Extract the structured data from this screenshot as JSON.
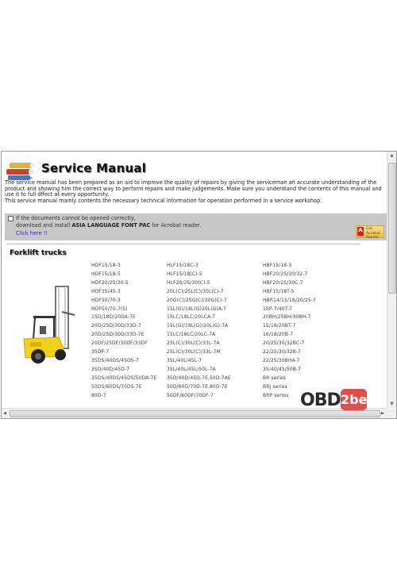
{
  "header": {
    "title": "Service Manual"
  },
  "intro": {
    "paragraph1": "The service manual has been prepared as an aid to improve the quality of repairs by giving the serviceman an accurate understanding of the product and showing him the correct way to perform repairs and make judgements. Make sure you understand the contents of this manual and use it to full dffect at every opportunity.",
    "paragraph2": "This service manual mainly contents the necessary technical information for operation performed in a service workshop."
  },
  "notice": {
    "line1": "If the documents cannot be opened correctly,",
    "line2_prefix": "download and install ",
    "line2_bold": "ASIA LANGUAGE FONT PAC",
    "line2_suffix": " for Acrobat reader.",
    "link": "Click here !!",
    "acrobat_badge": {
      "logo": "A",
      "text_line1": "Get Acrobat",
      "text_line2": "Reader"
    }
  },
  "section": {
    "title": "Forklift trucks",
    "columns": [
      [
        "HDF15/18-3",
        "HDF15/18-5",
        "HDF20/25/30-5",
        "HDF35/45-3",
        "HDF50/70-3",
        "HDF50/70-7(S)",
        "15D/18D/20DA-7E",
        "20D/25D/30D/33D-7",
        "20D/25D/30D/33D-7E",
        "20DF/25DF/30DF/33DF",
        "35DF-7",
        "35DS/40DS/45DS-7",
        "35D/40D/45D-7",
        "35DS/40DS/45DS/50DA-7E",
        "50DS/60DS/70DS-7E",
        "80D-7"
      ],
      [
        "HLF15/18C-3",
        "HLF15/18(C)-5",
        "HLF20/25/30(C)-5",
        "20L(C)/25L(C)/30L(C)-7",
        "20G(C)/25G(C)/30G(C)-7",
        "15L(G)/18L(G)20L(G)A-7",
        "15LC/18LC/20LCA-7",
        "15L(G)/18L(G)/20L(G)-7A",
        "15LC/18LC/20LC-7A",
        "25L(C)/30L(C)/33L-7A",
        "25L(C)/30L(C)/33L-7M",
        "35L/40L/45L-7",
        "35L/40L/45L/50L-7A",
        "35D/40D/45D-7E,50D-7AE",
        "50D/60D/70D-7E,80D-7E",
        "50DF/60DF/70DF-7"
      ],
      [
        "HBF15/18-3",
        "HBF20/25/30/32-7",
        "HBF20/25/30C-7",
        "HBF15/18T-5",
        "HBR14/15/18/20/25-7",
        "15P-7/40T-7",
        "20BH/25BH/30BH-7",
        "15/18/20BT-7",
        "16/18/20B-7",
        "20/25/30/32BC-7",
        "22/25/30/32B-7",
        "22/25/30BHA-7",
        "35/40/45/50B-7",
        "BR series",
        "BRJ series",
        "BRP series"
      ]
    ]
  },
  "scrollbars": {
    "up_arrow": "▲",
    "down_arrow": "▼",
    "left_arrow": "◀",
    "right_arrow": "▶",
    "grip": "≡",
    "hgrip": "|||"
  },
  "watermark": {
    "left": "OBD",
    "right": "2be"
  }
}
